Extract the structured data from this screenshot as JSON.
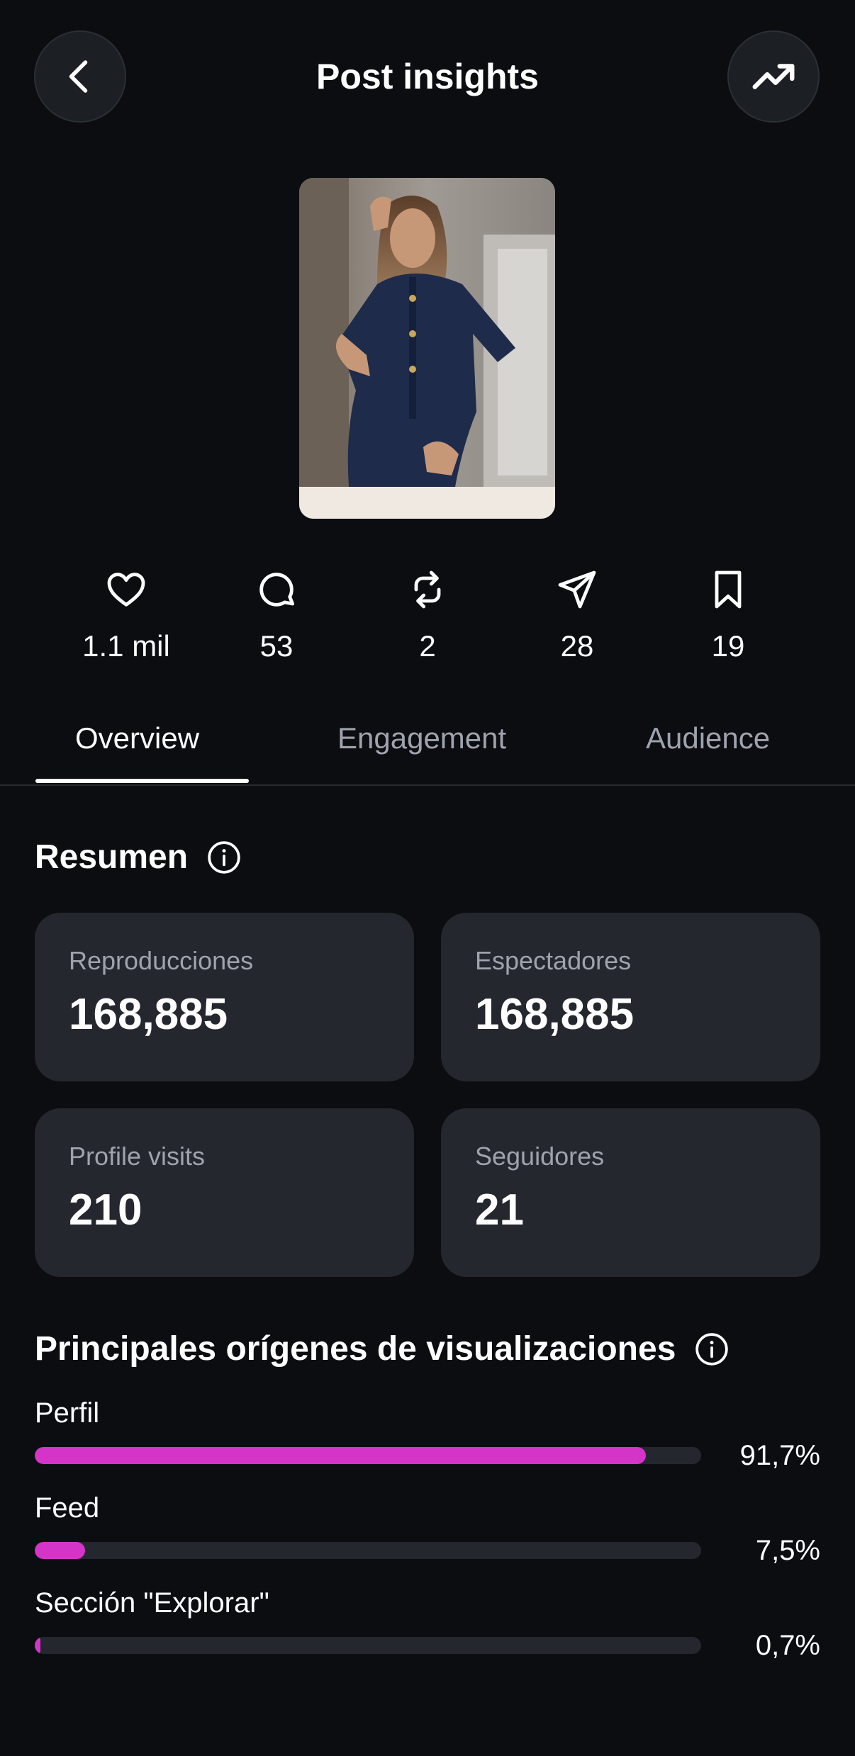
{
  "header": {
    "title": "Post insights",
    "back_icon": "chevron-left-icon",
    "trend_icon": "trending-up-icon"
  },
  "stats": [
    {
      "icon": "heart-icon",
      "value": "1.1 mil"
    },
    {
      "icon": "comment-icon",
      "value": "53"
    },
    {
      "icon": "repost-icon",
      "value": "2"
    },
    {
      "icon": "send-icon",
      "value": "28"
    },
    {
      "icon": "bookmark-icon",
      "value": "19"
    }
  ],
  "tabs": [
    {
      "label": "Overview",
      "active": true
    },
    {
      "label": "Engagement",
      "active": false
    },
    {
      "label": "Audience",
      "active": false
    }
  ],
  "summary": {
    "title": "Resumen",
    "cards": [
      {
        "label": "Reproducciones",
        "value": "168,885"
      },
      {
        "label": "Espectadores",
        "value": "168,885"
      },
      {
        "label": "Profile visits",
        "value": "210"
      },
      {
        "label": "Seguidores",
        "value": "21"
      }
    ]
  },
  "sources": {
    "title": "Principales orígenes de visualizaciones",
    "accent_color": "#d534c9",
    "items": [
      {
        "label": "Perfil",
        "percent_text": "91,7%",
        "fraction": 0.917
      },
      {
        "label": "Feed",
        "percent_text": "7,5%",
        "fraction": 0.075
      },
      {
        "label": "Sección \"Explorar\"",
        "percent_text": "0,7%",
        "fraction": 0.007
      }
    ]
  }
}
